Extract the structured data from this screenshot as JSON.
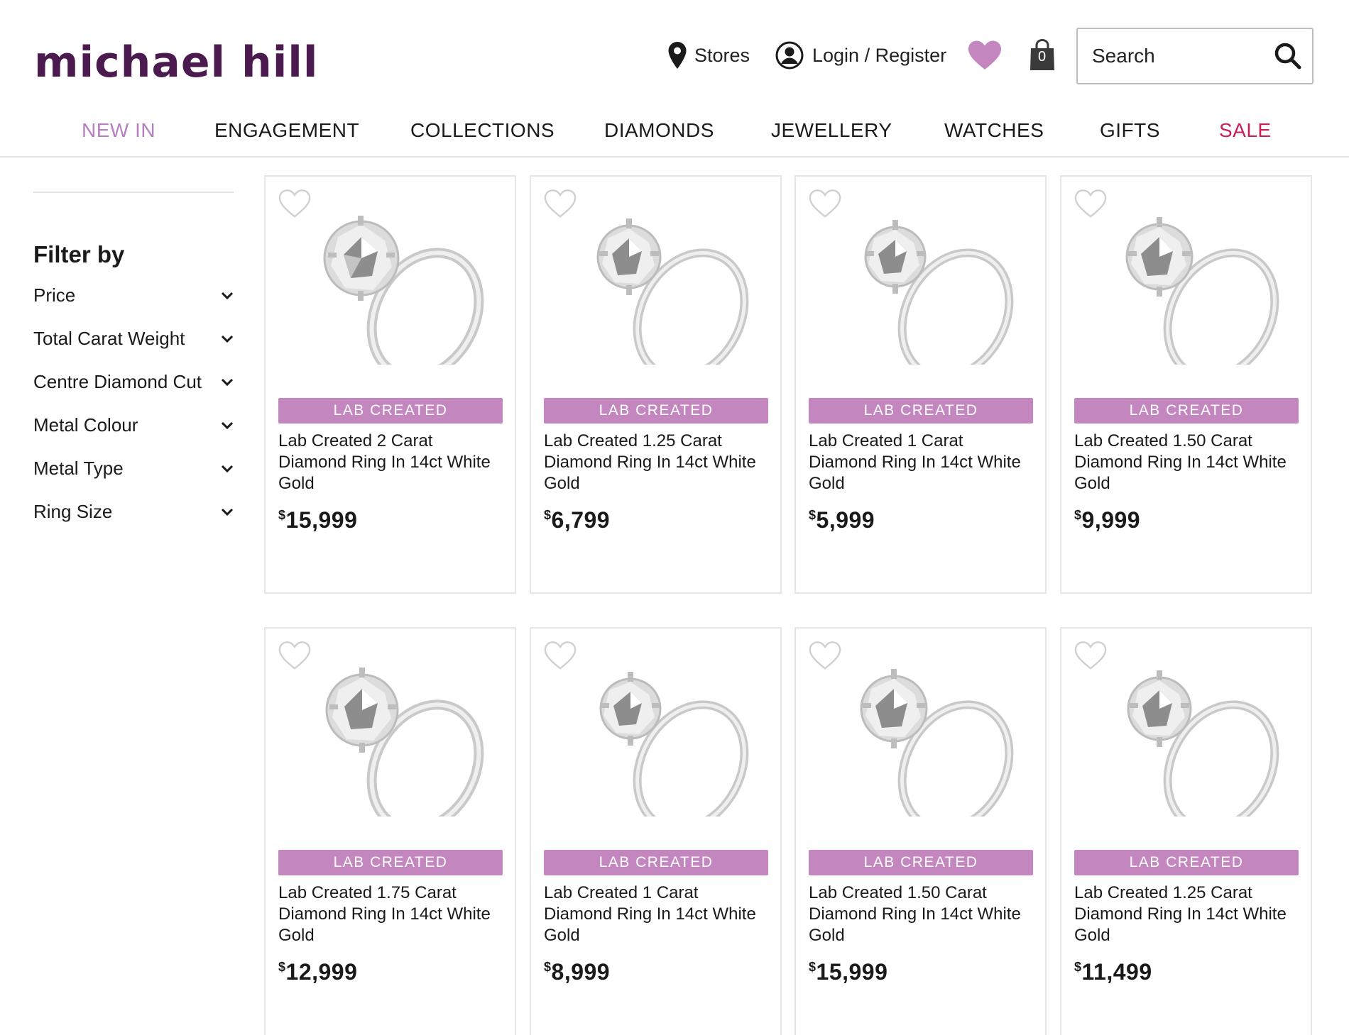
{
  "brand": {
    "logo_text": "michael hill"
  },
  "header": {
    "stores_label": "Stores",
    "login_label": "Login / Register",
    "bag_count": "0",
    "search_placeholder": "Search"
  },
  "nav": {
    "items": [
      "NEW IN",
      "ENGAGEMENT",
      "COLLECTIONS",
      "DIAMONDS",
      "JEWELLERY",
      "WATCHES",
      "GIFTS",
      "SALE"
    ]
  },
  "sidebar": {
    "title": "Filter by",
    "filters": [
      "Price",
      "Total Carat Weight",
      "Centre Diamond Cut",
      "Metal Colour",
      "Metal Type",
      "Ring Size"
    ]
  },
  "products": [
    {
      "badge": "LAB CREATED",
      "title": "Lab Created 2 Carat Diamond Ring In 14ct White Gold",
      "currency": "$",
      "price": "15,999"
    },
    {
      "badge": "LAB CREATED",
      "title": "Lab Created 1.25 Carat Diamond Ring In 14ct White Gold",
      "currency": "$",
      "price": "6,799"
    },
    {
      "badge": "LAB CREATED",
      "title": "Lab Created 1 Carat Diamond Ring In 14ct White Gold",
      "currency": "$",
      "price": "5,999"
    },
    {
      "badge": "LAB CREATED",
      "title": "Lab Created 1.50 Carat Diamond Ring In 14ct White Gold",
      "currency": "$",
      "price": "9,999"
    },
    {
      "badge": "LAB CREATED",
      "title": "Lab Created 1.75 Carat Diamond Ring In 14ct White Gold",
      "currency": "$",
      "price": "12,999"
    },
    {
      "badge": "LAB CREATED",
      "title": "Lab Created 1 Carat Diamond Ring In 14ct White Gold",
      "currency": "$",
      "price": "8,999"
    },
    {
      "badge": "LAB CREATED",
      "title": "Lab Created 1.50 Carat Diamond Ring In 14ct White Gold",
      "currency": "$",
      "price": "15,999"
    },
    {
      "badge": "LAB CREATED",
      "title": "Lab Created 1.25 Carat Diamond Ring In 14ct White Gold",
      "currency": "$",
      "price": "11,499"
    }
  ],
  "colors": {
    "brand_purple": "#4b1b4f",
    "badge": "#c486bf",
    "new_in": "#b67fc2",
    "sale": "#c81e5b",
    "wishlist_heart": "#c486bf"
  },
  "icons": {
    "stores": "map-pin-icon",
    "login": "user-circle-icon",
    "wishlist": "heart-icon",
    "bag": "shopping-bag-icon",
    "search": "magnifier-icon",
    "filter_toggle": "chevron-down-icon",
    "product_wishlist": "heart-outline-icon"
  }
}
